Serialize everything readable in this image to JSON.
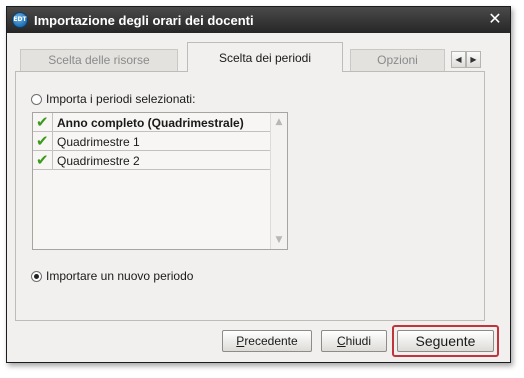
{
  "window": {
    "title": "Importazione degli orari dei docenti",
    "app_icon_text": "EDT",
    "close_glyph": "✕"
  },
  "tabs": [
    {
      "label": "Scelta delle risorse",
      "active": false
    },
    {
      "label": "Scelta dei periodi",
      "active": true
    },
    {
      "label": "Opzioni",
      "active": false
    }
  ],
  "tab_nav": {
    "prev_glyph": "◀",
    "next_glyph": "▶"
  },
  "options": {
    "import_selected": {
      "label": "Importa i periodi selezionati:",
      "checked": false
    },
    "import_new": {
      "label": "Importare un nuovo periodo",
      "checked": true
    }
  },
  "periods": [
    {
      "label": "Anno completo (Quadrimestrale)",
      "checked": true,
      "bold": true
    },
    {
      "label": "Quadrimestre 1",
      "checked": true,
      "bold": false
    },
    {
      "label": "Quadrimestre 2",
      "checked": true,
      "bold": false
    }
  ],
  "check_glyph": "✔",
  "scroll": {
    "up_glyph": "▲",
    "down_glyph": "▼"
  },
  "buttons": {
    "previous": {
      "underline": "P",
      "rest": "recedente"
    },
    "close": {
      "underline": "C",
      "rest": "hiudi"
    },
    "next": {
      "underline": "S",
      "rest": "eguente"
    }
  },
  "colors": {
    "check": "#3a9a1a",
    "highlight_border": "#c0343c",
    "titlebar": "#2e2e2e"
  }
}
